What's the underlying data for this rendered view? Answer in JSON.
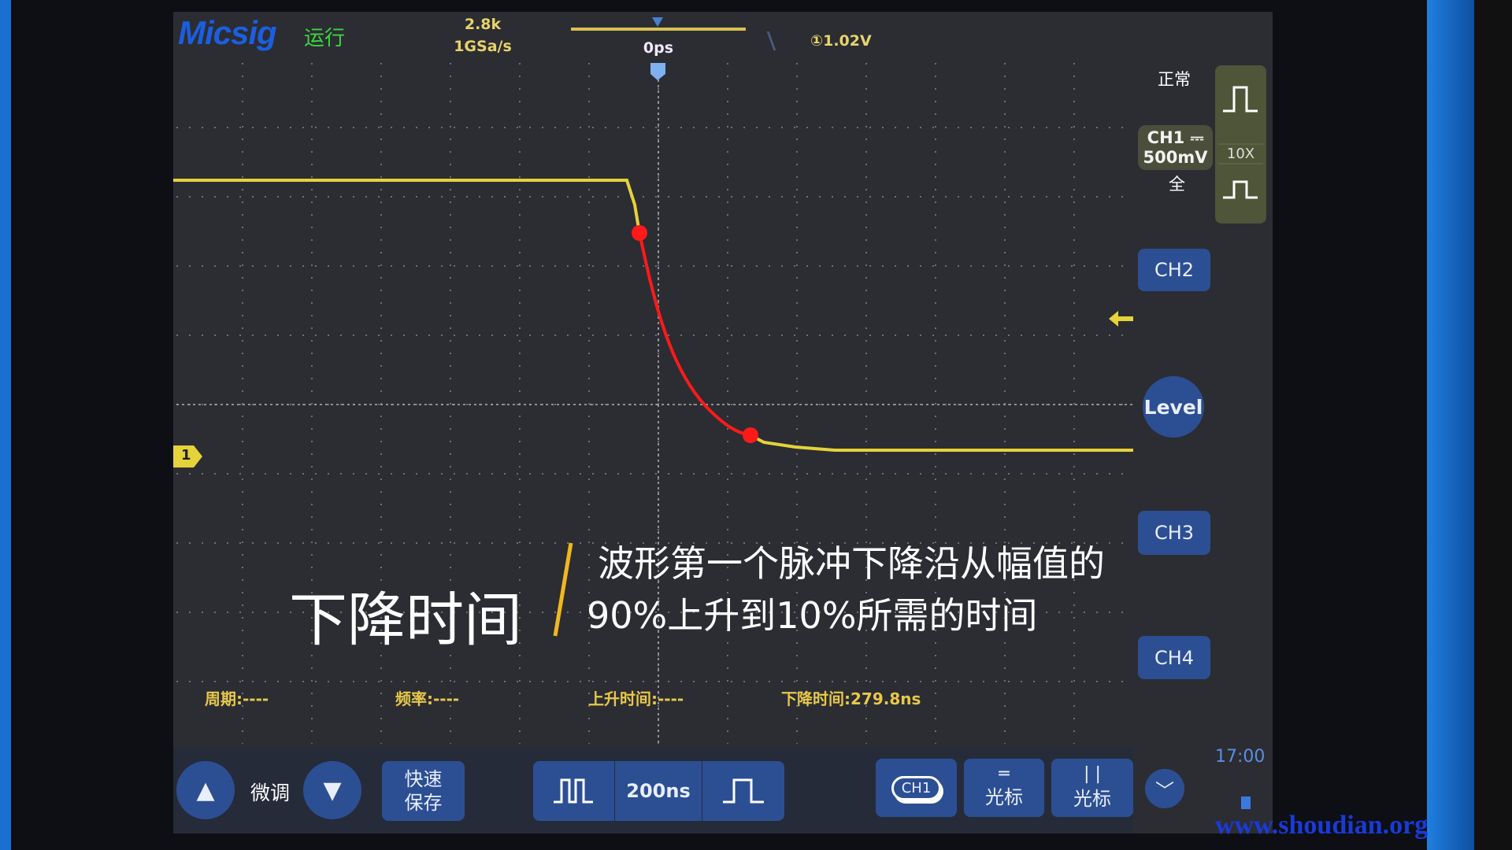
{
  "header": {
    "brand": "Micsig",
    "run_state": "运行",
    "memory_depth": "2.8k",
    "sample_rate": "1GSa/s",
    "time_offset": "0ps",
    "trigger_level": "1.02V",
    "trigger_marker": "T"
  },
  "right_panel": {
    "trigger_mode": "正常",
    "ch1_label": "CH1",
    "ch1_coupling": "⎓",
    "ch1_scale": "500mV",
    "bandwidth": "全",
    "probe": "10X",
    "ch2": "CH2",
    "level": "Level",
    "ch3": "CH3",
    "ch4": "CH4",
    "time": "17:00"
  },
  "channel_marker": "1",
  "overlay": {
    "title": "下降时间",
    "line1": "波形第一个脉冲下降沿从幅值的",
    "line2": "90%上升到10%所需的时间"
  },
  "measurements": {
    "period": "周期:----",
    "frequency": "频率:----",
    "rise_time": "上升时间:----",
    "fall_time": "下降时间:279.8ns"
  },
  "bottom_bar": {
    "fine_tune": "微调",
    "quick_save": "快速保存",
    "timebase": "200ns",
    "ch1": "CH1",
    "cursor_h": "光标",
    "cursor_v": "光标"
  },
  "watermark": "www.shoudian.org",
  "colors": {
    "trace": "#e6d23a",
    "highlight": "#ff1a1a",
    "button": "#2c4f93",
    "brand": "#1c5ee0"
  }
}
